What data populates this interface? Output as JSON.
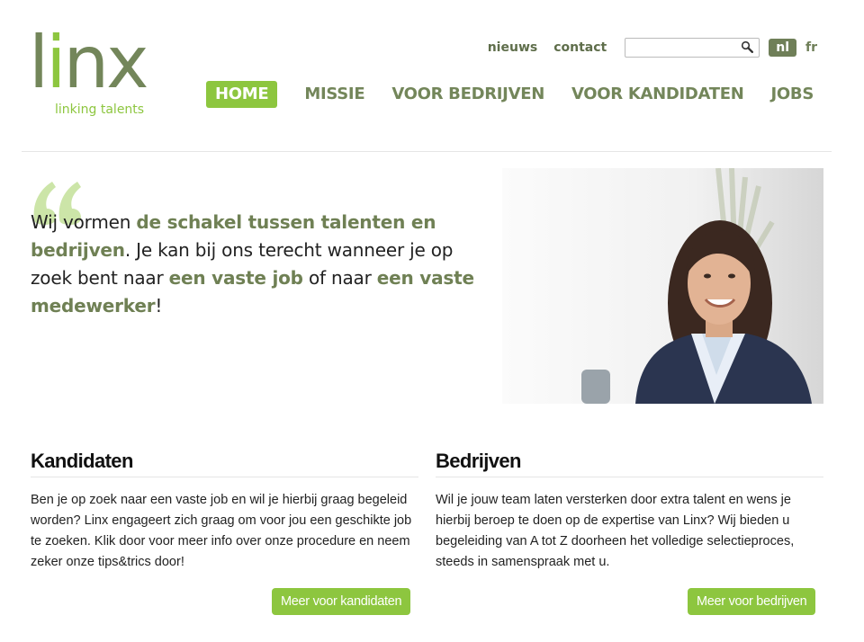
{
  "brand": {
    "logo_text": "linx",
    "tagline": "linking talents"
  },
  "colors": {
    "brand_green": "#8dc63f",
    "brand_olive": "#73865a",
    "text": "#222222"
  },
  "utility_nav": {
    "news": "nieuws",
    "contact": "contact",
    "search_placeholder": "",
    "search_icon": "magnifier-icon",
    "lang_active": "nl",
    "lang_other": "fr"
  },
  "main_nav": [
    {
      "label": "HOME",
      "active": true
    },
    {
      "label": "MISSIE",
      "active": false
    },
    {
      "label": "VOOR BEDRIJVEN",
      "active": false
    },
    {
      "label": "VOOR KANDIDATEN",
      "active": false
    },
    {
      "label": "JOBS",
      "active": false
    }
  ],
  "hero": {
    "quote_icon": "quote-icon",
    "t1": "Wij vormen ",
    "h1": "de schakel tussen talenten en bedrijven",
    "t2": ". Je kan bij ons terecht wanneer je op zoek bent naar ",
    "h2": "een vaste job",
    "t3": " of naar ",
    "h3": "een vaste medewerker",
    "t4": "!"
  },
  "kandidaten": {
    "title": "Kandidaten",
    "body": "Ben je op zoek naar een vaste job en wil je hierbij graag begeleid worden? Linx engageert zich graag om voor jou een geschikte job te zoeken. Klik door voor meer info over onze procedure en neem zeker onze tips&trics door!",
    "button": "Meer voor kandidaten"
  },
  "bedrijven": {
    "title": "Bedrijven",
    "body": "Wil je jouw team laten versterken door extra talent en wens je hierbij beroep te doen op de expertise van Linx? Wij bieden u begeleiding van A tot Z doorheen het volledige selectieproces, steeds in samenspraak met u.",
    "button": "Meer voor bedrijven"
  }
}
